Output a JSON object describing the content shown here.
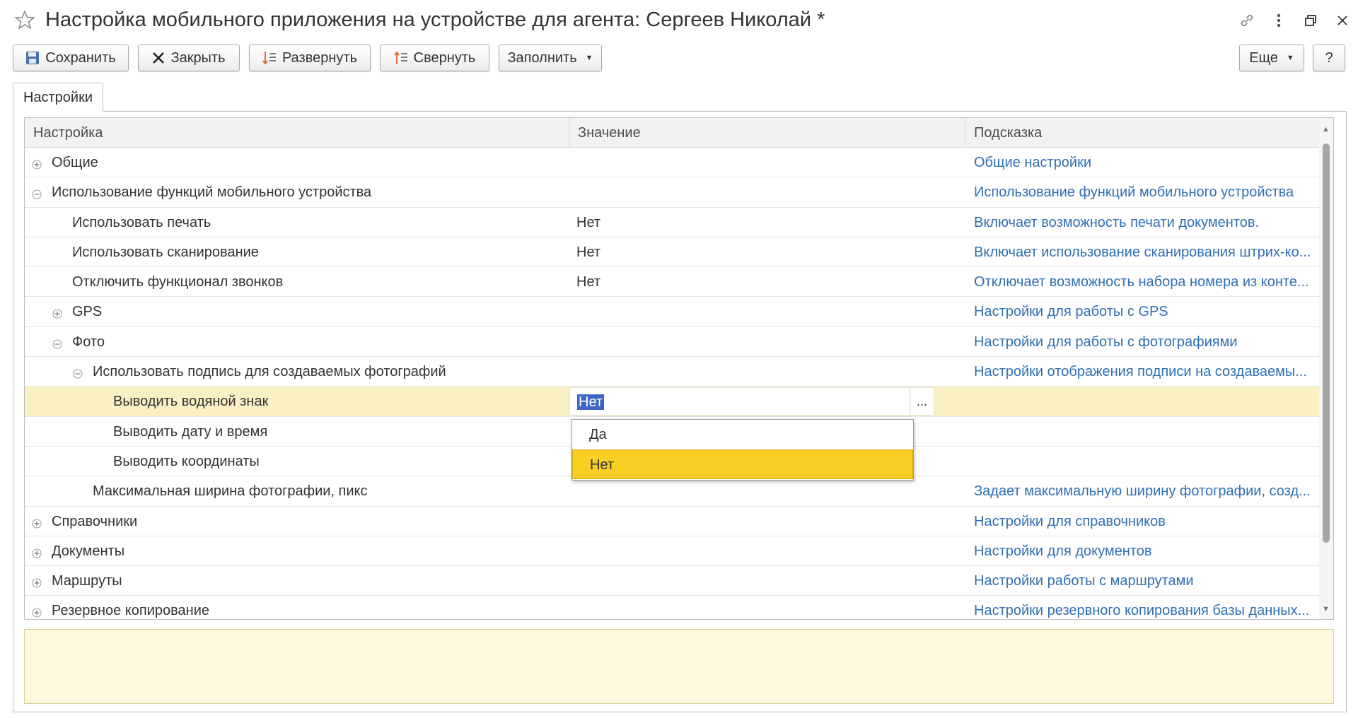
{
  "window": {
    "title": "Настройка мобильного приложения на устройстве для агента: Сергеев Николай *"
  },
  "toolbar": {
    "save_label": "Сохранить",
    "close_label": "Закрыть",
    "expand_label": "Развернуть",
    "collapse_label": "Свернуть",
    "fill_label": "Заполнить",
    "more_label": "Еще",
    "help_label": "?"
  },
  "tabs": [
    {
      "label": "Настройки",
      "active": true
    }
  ],
  "table": {
    "headers": [
      "Настройка",
      "Значение",
      "Подсказка"
    ],
    "rows": [
      {
        "name": "Общие",
        "value": "",
        "hint": "Общие настройки",
        "level": 0,
        "toggle": "plus"
      },
      {
        "name": "Использование функций мобильного устройства",
        "value": "",
        "hint": "Использование функций мобильного устройства",
        "level": 0,
        "toggle": "minus"
      },
      {
        "name": "Использовать печать",
        "value": "Нет",
        "hint": "Включает возможность печати документов.",
        "level": 1,
        "toggle": ""
      },
      {
        "name": "Использовать сканирование",
        "value": "Нет",
        "hint": "Включает использование сканирования штрих-ко...",
        "level": 1,
        "toggle": ""
      },
      {
        "name": "Отключить функционал звонков",
        "value": "Нет",
        "hint": "Отключает возможность набора номера из конте...",
        "level": 1,
        "toggle": ""
      },
      {
        "name": "GPS",
        "value": "",
        "hint": "Настройки для работы с GPS",
        "level": 1,
        "toggle": "plus"
      },
      {
        "name": "Фото",
        "value": "",
        "hint": "Настройки для работы с фотографиями",
        "level": 1,
        "toggle": "minus"
      },
      {
        "name": "Использовать подпись для создаваемых фотографий",
        "value": "",
        "hint": "Настройки отображения подписи на создаваемы...",
        "level": 2,
        "toggle": "minus"
      },
      {
        "name": "Выводить водяной знак",
        "value": "Нет",
        "hint": "",
        "level": 3,
        "toggle": "",
        "selected": true,
        "editing": true
      },
      {
        "name": "Выводить дату и время",
        "value": "",
        "hint": "",
        "level": 3,
        "toggle": ""
      },
      {
        "name": "Выводить координаты",
        "value": "",
        "hint": "",
        "level": 3,
        "toggle": ""
      },
      {
        "name": "Максимальная ширина фотографии, пикс",
        "value": "",
        "hint": "Задает максимальную ширину фотографии, созд...",
        "level": 2,
        "toggle": ""
      },
      {
        "name": "Справочники",
        "value": "",
        "hint": "Настройки для справочников",
        "level": 0,
        "toggle": "plus"
      },
      {
        "name": "Документы",
        "value": "",
        "hint": "Настройки для документов",
        "level": 0,
        "toggle": "plus"
      },
      {
        "name": "Маршруты",
        "value": "",
        "hint": "Настройки работы с маршрутами",
        "level": 0,
        "toggle": "plus"
      },
      {
        "name": "Резервное копирование",
        "value": "",
        "hint": "Настройки резервного копирования базы данных...",
        "level": 0,
        "toggle": "plus"
      }
    ]
  },
  "dropdown": {
    "options": [
      "Да",
      "Нет"
    ],
    "selected": "Нет"
  },
  "colors": {
    "hint_link": "#2f6fb3",
    "selected_row": "#fbf0c4",
    "dropdown_active": "#f9cf24",
    "edit_selection": "#3b66c4",
    "hint_area": "#fdf8de"
  }
}
